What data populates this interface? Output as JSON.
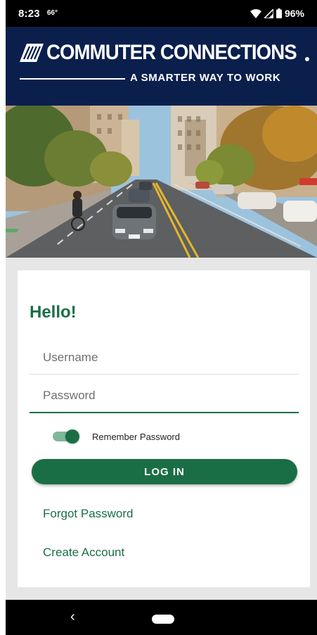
{
  "status_bar": {
    "time": "8:23",
    "temperature": "66°",
    "battery": "96%",
    "icons": [
      "wifi-icon",
      "signal-icon",
      "battery-icon"
    ]
  },
  "header": {
    "brand_name": "COMMUTER CONNECTIONS",
    "tagline": "A SMARTER WAY TO WORK",
    "background_color": "#0b1f4d"
  },
  "login": {
    "greeting": "Hello!",
    "username_placeholder": "Username",
    "username_value": "",
    "password_placeholder": "Password",
    "password_value": "",
    "remember_label": "Remember Password",
    "remember_enabled": true,
    "login_label": "LOG IN",
    "forgot_label": "Forgot Password",
    "create_label": "Create Account",
    "accent_color": "#1a6e45"
  },
  "nav": {
    "back_glyph": "‹"
  }
}
